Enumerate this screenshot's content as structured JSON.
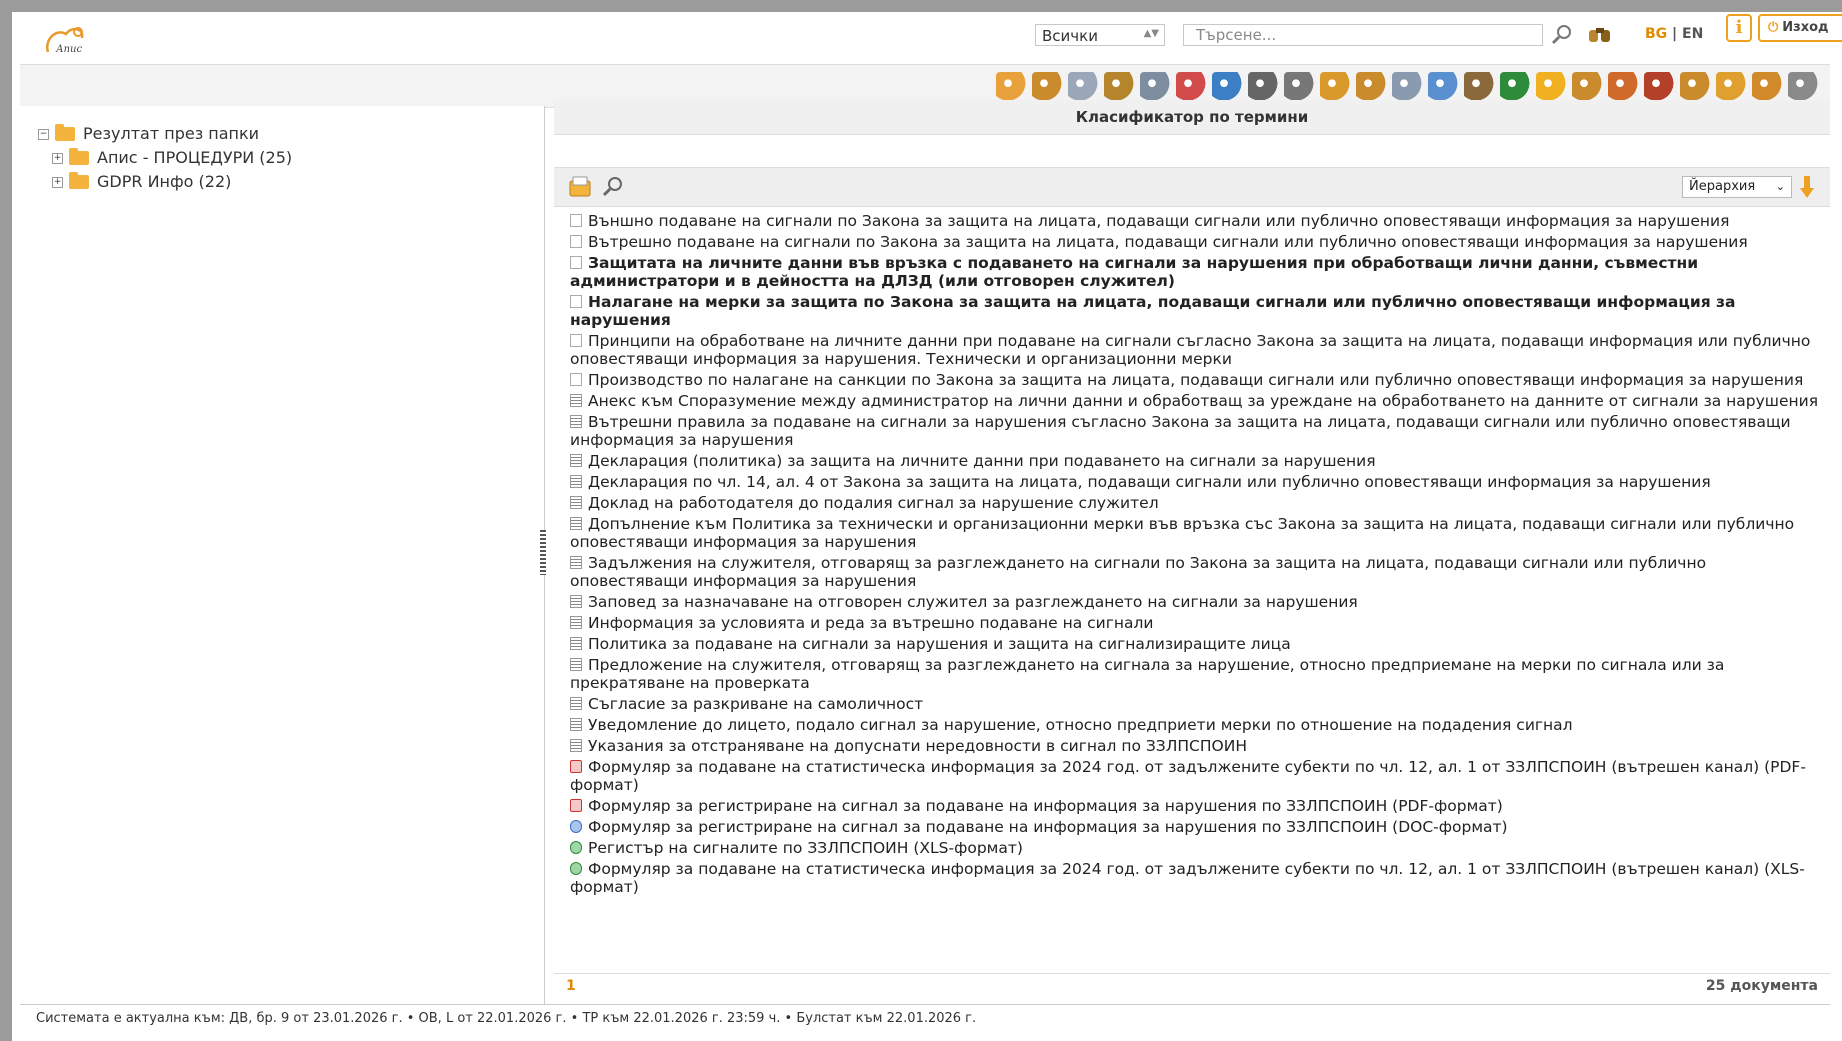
{
  "header": {
    "logo_text": "Апис",
    "category_select": "Всички",
    "search_placeholder": "Търсене...",
    "lang_bg": "BG",
    "lang_sep": "|",
    "lang_en": "EN",
    "info_label": "i",
    "exit_label": "Изход",
    "accent": "#f0a020"
  },
  "toolbar": {
    "icons": [
      "folder-open-icon",
      "folder-search-icon",
      "copy-icon",
      "binoculars-icon",
      "law-text-icon",
      "pdf-icon",
      "rtf-icon",
      "print-icon",
      "print-preview-icon",
      "timeline-icon",
      "sum-icon",
      "search-tp-icon",
      "tree-tp-icon",
      "people-icon",
      "excel-icon",
      "help-icon",
      "scales-icon",
      "judge-icon",
      "court-icon",
      "stats-icon",
      "chart-icon",
      "hands-icon",
      "settings-icon"
    ]
  },
  "tree": {
    "root_label": "Резултат през папки",
    "children": [
      {
        "label": "Апис - ПРОЦЕДУРИ (25)"
      },
      {
        "label": "GDPR Инфо (22)"
      }
    ]
  },
  "panel": {
    "title": "Класификатор по термини",
    "view_select": "Йерархия"
  },
  "documents": [
    {
      "icon": "page",
      "bold": false,
      "text": "Външно подаване на сигнали по Закона за защита на лицата, подаващи сигнали или публично оповестяващи информация за нарушения"
    },
    {
      "icon": "page",
      "bold": false,
      "text": "Вътрешно подаване на сигнали по Закона за защита на лицата, подаващи сигнали или публично оповестяващи информация за нарушения"
    },
    {
      "icon": "page",
      "bold": true,
      "text": "Защитата на личните данни във връзка с подаването на сигнали за нарушения при обработващи лични данни, съвместни администратори и в дейността на ДЛЗД (или отговорен служител)"
    },
    {
      "icon": "page",
      "bold": true,
      "text": "Налагане на мерки за защита по Закона за защита на лицата, подаващи сигнали или публично оповестяващи информация за нарушения"
    },
    {
      "icon": "page",
      "bold": false,
      "text": "Принципи на обработване на личните данни при подаване на сигнали съгласно Закона за защита на лицата, подаващи информация или публично оповестяващи информация за нарушения. Технически и организационни мерки"
    },
    {
      "icon": "page",
      "bold": false,
      "text": "Производство по налагане на санкции по Закона за защита на лицата, подаващи сигнали или публично оповестяващи информация за нарушения"
    },
    {
      "icon": "doc",
      "bold": false,
      "text": "Анекс към Споразумение между администратор на лични данни и обработващ за уреждане на обработването на данните от сигнали за нарушения"
    },
    {
      "icon": "doc",
      "bold": false,
      "text": "Вътрешни правила за подаване на сигнали за нарушения съгласно Закона за защита на лицата, подаващи сигнали или публично оповестяващи информация за нарушения"
    },
    {
      "icon": "doc",
      "bold": false,
      "text": "Декларация (политика) за защита на личните данни при подаването на сигнали за нарушения"
    },
    {
      "icon": "doc",
      "bold": false,
      "text": "Декларация по чл. 14, ал. 4 от Закона за защита на лицата, подаващи сигнали или публично оповестяващи информация за нарушения"
    },
    {
      "icon": "doc",
      "bold": false,
      "text": "Доклад на работодателя до подалия сигнал за нарушение служител"
    },
    {
      "icon": "doc",
      "bold": false,
      "text": "Допълнение към Политика за технически и организационни мерки във връзка със Закона за защита на лицата, подаващи сигнали или публично оповестяващи информация за нарушения"
    },
    {
      "icon": "doc",
      "bold": false,
      "text": "Задължения на служителя, отговарящ за разглеждането на сигнали по Закона за защита на лицата, подаващи сигнали или публично оповестяващи информация за нарушения"
    },
    {
      "icon": "doc",
      "bold": false,
      "text": "Заповед за назначаване на отговорен служител за разглеждането на сигнали за нарушения"
    },
    {
      "icon": "doc",
      "bold": false,
      "text": "Информация за условията и реда за вътрешно подаване на сигнали"
    },
    {
      "icon": "doc",
      "bold": false,
      "text": "Политика за подаване на сигнали за нарушения и защита на сигнализиращите лица"
    },
    {
      "icon": "doc",
      "bold": false,
      "text": "Предложение на служителя, отговарящ за разглеждането на сигнала за нарушение, относно предприемане на мерки по сигнала или за прекратяване на проверката"
    },
    {
      "icon": "doc",
      "bold": false,
      "text": "Съгласие за разкриване на самоличност"
    },
    {
      "icon": "doc",
      "bold": false,
      "text": "Уведомление до лицето, подало сигнал за нарушение, относно предприети мерки по отношение на подадения сигнал"
    },
    {
      "icon": "doc",
      "bold": false,
      "text": "Указания за отстраняване на допуснати нередовности в сигнал по ЗЗЛПСПОИН"
    },
    {
      "icon": "pdf",
      "bold": false,
      "text": "Формуляр за подаване на статистическа информация за 2024 год. от задължените субекти по чл. 12, ал. 1 от ЗЗЛПСПОИН (вътрешен канал) (PDF-формат)"
    },
    {
      "icon": "pdf",
      "bold": false,
      "text": "Формуляр за регистриране на сигнал за подаване на информация за нарушения по ЗЗЛПСПОИН (PDF-формат)"
    },
    {
      "icon": "word",
      "bold": false,
      "text": "Формуляр за регистриране на сигнал за подаване на информация за нарушения по ЗЗЛПСПОИН (DOC-формат)"
    },
    {
      "icon": "excel",
      "bold": false,
      "text": "Регистър на сигналите по ЗЗЛПСПОИН (XLS-формат)"
    },
    {
      "icon": "excel",
      "bold": false,
      "text": "Формуляр за подаване на статистическа информация за 2024 год. от задължените субекти по чл. 12, ал. 1 от ЗЗЛПСПОИН (вътрешен канал) (XLS-формат)"
    }
  ],
  "footer": {
    "page": "1",
    "count": "25 документа"
  },
  "status": "Системата е актуална към: ДВ, бр. 9 от 23.01.2026 г. • ОВ, L от 22.01.2026 г. • ТР към 22.01.2026 г. 23:59 ч. • Булстат към 22.01.2026 г."
}
